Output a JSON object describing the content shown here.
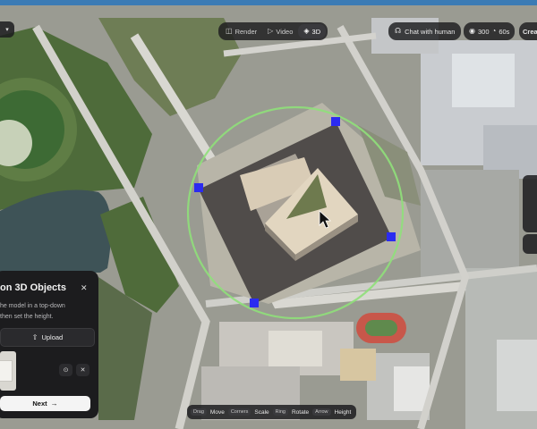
{
  "toolbar": {
    "left_chip": "▾",
    "render": {
      "label": "Render",
      "icon": "render-icon"
    },
    "video": {
      "label": "Video",
      "icon": "video-icon"
    },
    "three_d": {
      "label": "3D",
      "icon": "3d-icon",
      "active": true
    },
    "chat": {
      "label": "Chat with human",
      "icon": "headset-icon"
    },
    "stats": {
      "value1": "300",
      "value2": "60s",
      "icon": "camera-icon"
    },
    "create": "Creat"
  },
  "panel": {
    "title": "on 3D Objects",
    "description_line1": "he model in a top-down",
    "description_line2": "then set the height.",
    "upload_label": "Upload",
    "next_label": "Next"
  },
  "hints": [
    {
      "key": "Drag",
      "action": "Move"
    },
    {
      "key": "Corners",
      "action": "Scale"
    },
    {
      "key": "Ring",
      "action": "Rotate"
    },
    {
      "key": "Arrow",
      "action": "Height"
    }
  ],
  "colors": {
    "handle": "#2b2bf0",
    "ring": "#8fe07a",
    "panel_bg": "#1c1c1e",
    "model_top": "#d8c9b2",
    "shadow": "#454240"
  }
}
